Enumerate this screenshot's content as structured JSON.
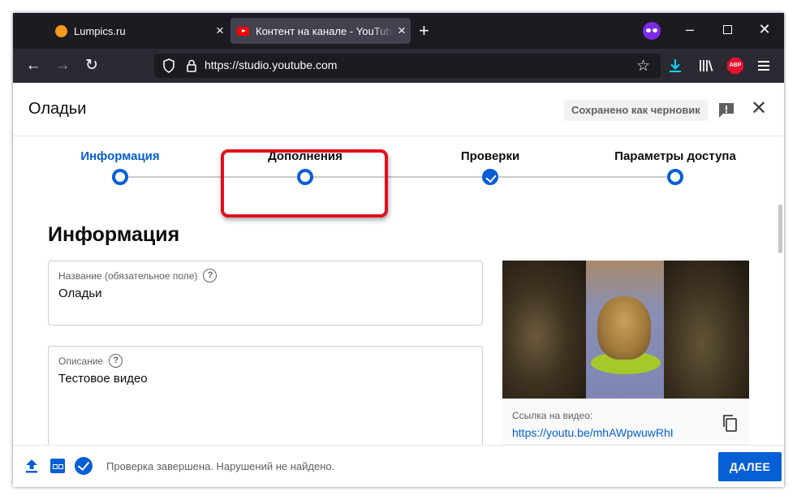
{
  "browser": {
    "tabs": [
      {
        "title": "Lumpics.ru",
        "active": false
      },
      {
        "title": "Контент на канале - YouTube Studio",
        "active": true
      }
    ],
    "new_tab_symbol": "+",
    "url": "https://studio.youtube.com",
    "toolbar_icons": [
      "back-arrow-icon",
      "forward-arrow-icon",
      "reload-icon",
      "shield-icon",
      "lock-icon",
      "bookmark-star-icon",
      "download-icon",
      "library-icon",
      "abp-icon",
      "menu-icon"
    ],
    "abp_text": "ABP",
    "colors": {
      "tab_bg": "#1c1b22",
      "nav_bg": "#2b2a33",
      "active_tab": "#42414d",
      "download_accent": "#00ddff"
    }
  },
  "dialog": {
    "title": "Оладьи",
    "draft_badge": "Сохранено как черновик",
    "steps": [
      {
        "label": "Информация",
        "state": "current"
      },
      {
        "label": "Дополнения",
        "state": "pending"
      },
      {
        "label": "Проверки",
        "state": "done"
      },
      {
        "label": "Параметры доступа",
        "state": "pending"
      }
    ],
    "section_title": "Информация",
    "fields": {
      "title": {
        "label": "Название (обязательное поле)",
        "value": "Оладьи"
      },
      "description": {
        "label": "Описание",
        "value": "Тестовое видео"
      }
    },
    "help_symbol": "?",
    "preview": {
      "link_label": "Ссылка на видео:",
      "link_value": "https://youtu.be/mhAWpwuwRhI"
    },
    "footer": {
      "status": "Проверка завершена. Нарушений не найдено.",
      "next_label": "ДАЛЕЕ"
    },
    "colors": {
      "accent": "#065fd4",
      "highlight": "#e0101c"
    }
  }
}
